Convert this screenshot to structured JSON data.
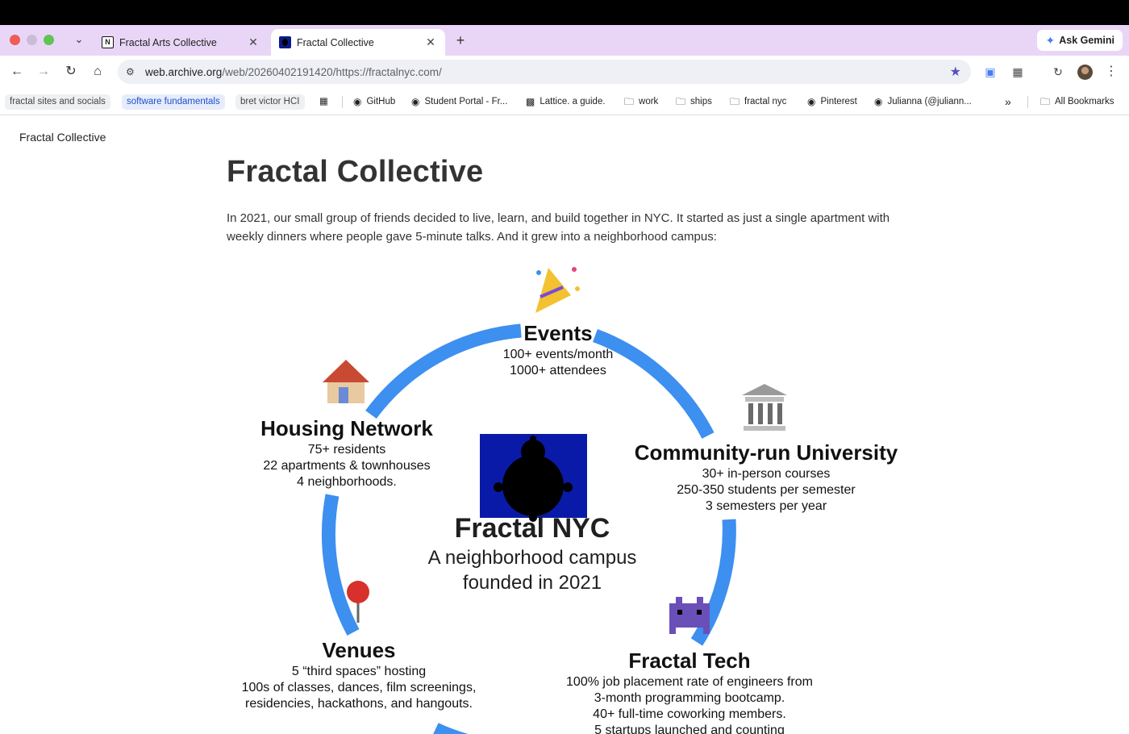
{
  "browser": {
    "tabs": [
      {
        "title": "Fractal Arts Collective",
        "favicon": "notion-icon",
        "active": false
      },
      {
        "title": "Fractal Collective",
        "favicon": "fractal-icon",
        "active": true
      }
    ],
    "new_tab": "+",
    "ask_gemini": "Ask Gemini",
    "url_host": "web.archive.org",
    "url_path": "/web/20260402191420/https://fractalnyc.com/",
    "accent_color": "#e9d6f7"
  },
  "bookmarks": {
    "items": [
      {
        "label": "fractal sites and socials",
        "type": "chip"
      },
      {
        "label": "software fundamentals",
        "type": "chip-blue"
      },
      {
        "label": "bret victor HCI",
        "type": "chip"
      },
      {
        "label": "GitHub",
        "icon": "globe-icon"
      },
      {
        "label": "Student Portal - Fr...",
        "icon": "globe-icon"
      },
      {
        "label": "Lattice. a guide.",
        "icon": "lattice-icon"
      },
      {
        "label": "work",
        "icon": "folder-icon"
      },
      {
        "label": "ships",
        "icon": "folder-icon"
      },
      {
        "label": "fractal nyc",
        "icon": "folder-icon"
      },
      {
        "label": "Pinterest",
        "icon": "globe-icon"
      },
      {
        "label": "Julianna (@juliann...",
        "icon": "globe-icon"
      }
    ],
    "overflow": "»",
    "all_bookmarks": "All Bookmarks"
  },
  "page": {
    "site_name": "Fractal Collective",
    "title": "Fractal Collective",
    "intro": "In 2021, our small group of friends decided to live, learn, and build together in NYC. It started as just a single apartment with weekly dinners where people gave 5-minute talks. And it grew into a neighborhood campus:"
  },
  "diagram": {
    "ring_color": "#3d8ff0",
    "center": {
      "label": "Fractal NYC",
      "line1": "A neighborhood campus",
      "line2": "founded in 2021"
    },
    "events": {
      "label": "Events",
      "lines": [
        "100+ events/month",
        "1000+ attendees"
      ]
    },
    "housing": {
      "label": "Housing Network",
      "lines": [
        "75+ residents",
        "22 apartments & townhouses",
        "4 neighborhoods."
      ]
    },
    "university": {
      "label": "Community-run University",
      "lines": [
        "30+ in-person courses",
        "250-350 students per semester",
        "3 semesters per year"
      ]
    },
    "venues": {
      "label": "Venues",
      "lines": [
        "5 “third spaces” hosting",
        "100s of classes, dances, film screenings,",
        "residencies, hackathons, and hangouts."
      ]
    },
    "tech": {
      "label": "Fractal Tech",
      "lines": [
        "100% job placement rate of engineers from",
        "3-month programming bootcamp.",
        "40+ full-time coworking members.",
        "5 startups launched and counting"
      ]
    }
  }
}
